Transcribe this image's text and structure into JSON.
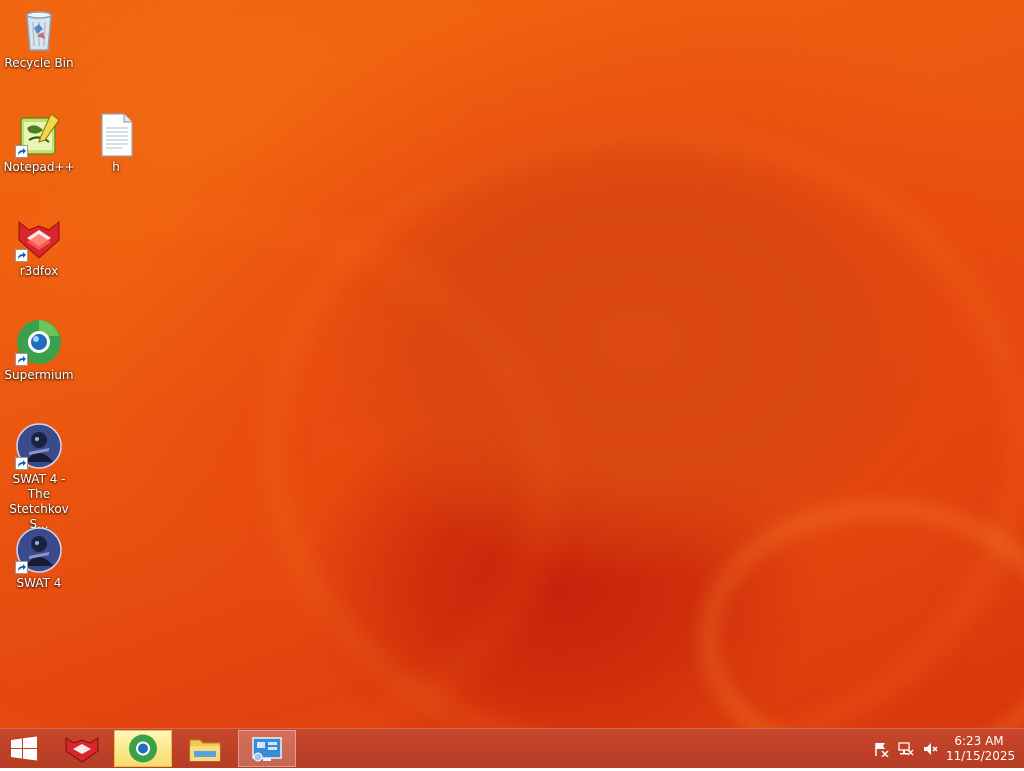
{
  "desktop": {
    "icons": [
      {
        "label": "Recycle Bin",
        "icon": "recycle-bin-icon"
      },
      {
        "label": "Notepad++",
        "icon": "notepadpp-icon",
        "shortcut": true
      },
      {
        "label": "h",
        "icon": "text-file-icon"
      },
      {
        "label": "r3dfox",
        "icon": "r3dfox-icon",
        "shortcut": true
      },
      {
        "label": "Supermium",
        "icon": "supermium-icon",
        "shortcut": true
      },
      {
        "label": "SWAT 4 - The Stetchkov S...",
        "icon": "swat4-icon",
        "shortcut": true
      },
      {
        "label": "SWAT 4",
        "icon": "swat4-icon",
        "shortcut": true
      }
    ]
  },
  "taskbar": {
    "start_icon": "windows-start-icon",
    "pinned": [
      {
        "icon": "r3dfox-icon",
        "state": "normal"
      },
      {
        "icon": "supermium-icon",
        "state": "highlighted"
      },
      {
        "icon": "file-explorer-icon",
        "state": "normal"
      },
      {
        "icon": "control-panel-icon",
        "state": "active"
      }
    ],
    "tray": {
      "icons": [
        "action-center-flag-icon",
        "network-icon",
        "volume-muted-icon"
      ],
      "time": "6:23 AM",
      "date": "11/15/2025"
    }
  },
  "colors": {
    "wallpaper_primary": "#f0640f",
    "wallpaper_dark": "#c8220c",
    "taskbar": "#c9462a"
  }
}
